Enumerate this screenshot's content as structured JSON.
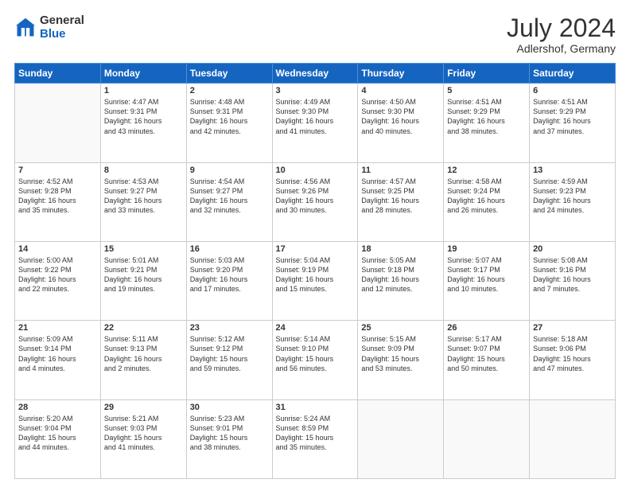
{
  "logo": {
    "general": "General",
    "blue": "Blue"
  },
  "title": {
    "month_year": "July 2024",
    "location": "Adlershof, Germany"
  },
  "headers": [
    "Sunday",
    "Monday",
    "Tuesday",
    "Wednesday",
    "Thursday",
    "Friday",
    "Saturday"
  ],
  "weeks": [
    [
      {
        "day": "",
        "info": ""
      },
      {
        "day": "1",
        "info": "Sunrise: 4:47 AM\nSunset: 9:31 PM\nDaylight: 16 hours\nand 43 minutes."
      },
      {
        "day": "2",
        "info": "Sunrise: 4:48 AM\nSunset: 9:31 PM\nDaylight: 16 hours\nand 42 minutes."
      },
      {
        "day": "3",
        "info": "Sunrise: 4:49 AM\nSunset: 9:30 PM\nDaylight: 16 hours\nand 41 minutes."
      },
      {
        "day": "4",
        "info": "Sunrise: 4:50 AM\nSunset: 9:30 PM\nDaylight: 16 hours\nand 40 minutes."
      },
      {
        "day": "5",
        "info": "Sunrise: 4:51 AM\nSunset: 9:29 PM\nDaylight: 16 hours\nand 38 minutes."
      },
      {
        "day": "6",
        "info": "Sunrise: 4:51 AM\nSunset: 9:29 PM\nDaylight: 16 hours\nand 37 minutes."
      }
    ],
    [
      {
        "day": "7",
        "info": "Sunrise: 4:52 AM\nSunset: 9:28 PM\nDaylight: 16 hours\nand 35 minutes."
      },
      {
        "day": "8",
        "info": "Sunrise: 4:53 AM\nSunset: 9:27 PM\nDaylight: 16 hours\nand 33 minutes."
      },
      {
        "day": "9",
        "info": "Sunrise: 4:54 AM\nSunset: 9:27 PM\nDaylight: 16 hours\nand 32 minutes."
      },
      {
        "day": "10",
        "info": "Sunrise: 4:56 AM\nSunset: 9:26 PM\nDaylight: 16 hours\nand 30 minutes."
      },
      {
        "day": "11",
        "info": "Sunrise: 4:57 AM\nSunset: 9:25 PM\nDaylight: 16 hours\nand 28 minutes."
      },
      {
        "day": "12",
        "info": "Sunrise: 4:58 AM\nSunset: 9:24 PM\nDaylight: 16 hours\nand 26 minutes."
      },
      {
        "day": "13",
        "info": "Sunrise: 4:59 AM\nSunset: 9:23 PM\nDaylight: 16 hours\nand 24 minutes."
      }
    ],
    [
      {
        "day": "14",
        "info": "Sunrise: 5:00 AM\nSunset: 9:22 PM\nDaylight: 16 hours\nand 22 minutes."
      },
      {
        "day": "15",
        "info": "Sunrise: 5:01 AM\nSunset: 9:21 PM\nDaylight: 16 hours\nand 19 minutes."
      },
      {
        "day": "16",
        "info": "Sunrise: 5:03 AM\nSunset: 9:20 PM\nDaylight: 16 hours\nand 17 minutes."
      },
      {
        "day": "17",
        "info": "Sunrise: 5:04 AM\nSunset: 9:19 PM\nDaylight: 16 hours\nand 15 minutes."
      },
      {
        "day": "18",
        "info": "Sunrise: 5:05 AM\nSunset: 9:18 PM\nDaylight: 16 hours\nand 12 minutes."
      },
      {
        "day": "19",
        "info": "Sunrise: 5:07 AM\nSunset: 9:17 PM\nDaylight: 16 hours\nand 10 minutes."
      },
      {
        "day": "20",
        "info": "Sunrise: 5:08 AM\nSunset: 9:16 PM\nDaylight: 16 hours\nand 7 minutes."
      }
    ],
    [
      {
        "day": "21",
        "info": "Sunrise: 5:09 AM\nSunset: 9:14 PM\nDaylight: 16 hours\nand 4 minutes."
      },
      {
        "day": "22",
        "info": "Sunrise: 5:11 AM\nSunset: 9:13 PM\nDaylight: 16 hours\nand 2 minutes."
      },
      {
        "day": "23",
        "info": "Sunrise: 5:12 AM\nSunset: 9:12 PM\nDaylight: 15 hours\nand 59 minutes."
      },
      {
        "day": "24",
        "info": "Sunrise: 5:14 AM\nSunset: 9:10 PM\nDaylight: 15 hours\nand 56 minutes."
      },
      {
        "day": "25",
        "info": "Sunrise: 5:15 AM\nSunset: 9:09 PM\nDaylight: 15 hours\nand 53 minutes."
      },
      {
        "day": "26",
        "info": "Sunrise: 5:17 AM\nSunset: 9:07 PM\nDaylight: 15 hours\nand 50 minutes."
      },
      {
        "day": "27",
        "info": "Sunrise: 5:18 AM\nSunset: 9:06 PM\nDaylight: 15 hours\nand 47 minutes."
      }
    ],
    [
      {
        "day": "28",
        "info": "Sunrise: 5:20 AM\nSunset: 9:04 PM\nDaylight: 15 hours\nand 44 minutes."
      },
      {
        "day": "29",
        "info": "Sunrise: 5:21 AM\nSunset: 9:03 PM\nDaylight: 15 hours\nand 41 minutes."
      },
      {
        "day": "30",
        "info": "Sunrise: 5:23 AM\nSunset: 9:01 PM\nDaylight: 15 hours\nand 38 minutes."
      },
      {
        "day": "31",
        "info": "Sunrise: 5:24 AM\nSunset: 8:59 PM\nDaylight: 15 hours\nand 35 minutes."
      },
      {
        "day": "",
        "info": ""
      },
      {
        "day": "",
        "info": ""
      },
      {
        "day": "",
        "info": ""
      }
    ]
  ]
}
